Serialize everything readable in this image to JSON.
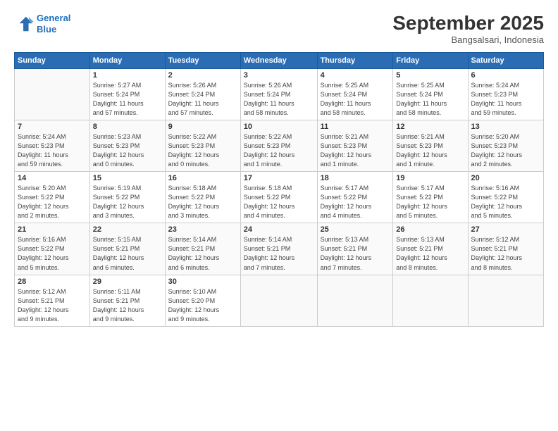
{
  "logo": {
    "line1": "General",
    "line2": "Blue"
  },
  "title": "September 2025",
  "subtitle": "Bangsalsari, Indonesia",
  "headers": [
    "Sunday",
    "Monday",
    "Tuesday",
    "Wednesday",
    "Thursday",
    "Friday",
    "Saturday"
  ],
  "weeks": [
    [
      {
        "day": "",
        "info": ""
      },
      {
        "day": "1",
        "info": "Sunrise: 5:27 AM\nSunset: 5:24 PM\nDaylight: 11 hours\nand 57 minutes."
      },
      {
        "day": "2",
        "info": "Sunrise: 5:26 AM\nSunset: 5:24 PM\nDaylight: 11 hours\nand 57 minutes."
      },
      {
        "day": "3",
        "info": "Sunrise: 5:26 AM\nSunset: 5:24 PM\nDaylight: 11 hours\nand 58 minutes."
      },
      {
        "day": "4",
        "info": "Sunrise: 5:25 AM\nSunset: 5:24 PM\nDaylight: 11 hours\nand 58 minutes."
      },
      {
        "day": "5",
        "info": "Sunrise: 5:25 AM\nSunset: 5:24 PM\nDaylight: 11 hours\nand 58 minutes."
      },
      {
        "day": "6",
        "info": "Sunrise: 5:24 AM\nSunset: 5:23 PM\nDaylight: 11 hours\nand 59 minutes."
      }
    ],
    [
      {
        "day": "7",
        "info": "Sunrise: 5:24 AM\nSunset: 5:23 PM\nDaylight: 11 hours\nand 59 minutes."
      },
      {
        "day": "8",
        "info": "Sunrise: 5:23 AM\nSunset: 5:23 PM\nDaylight: 12 hours\nand 0 minutes."
      },
      {
        "day": "9",
        "info": "Sunrise: 5:22 AM\nSunset: 5:23 PM\nDaylight: 12 hours\nand 0 minutes."
      },
      {
        "day": "10",
        "info": "Sunrise: 5:22 AM\nSunset: 5:23 PM\nDaylight: 12 hours\nand 1 minute."
      },
      {
        "day": "11",
        "info": "Sunrise: 5:21 AM\nSunset: 5:23 PM\nDaylight: 12 hours\nand 1 minute."
      },
      {
        "day": "12",
        "info": "Sunrise: 5:21 AM\nSunset: 5:23 PM\nDaylight: 12 hours\nand 1 minute."
      },
      {
        "day": "13",
        "info": "Sunrise: 5:20 AM\nSunset: 5:23 PM\nDaylight: 12 hours\nand 2 minutes."
      }
    ],
    [
      {
        "day": "14",
        "info": "Sunrise: 5:20 AM\nSunset: 5:22 PM\nDaylight: 12 hours\nand 2 minutes."
      },
      {
        "day": "15",
        "info": "Sunrise: 5:19 AM\nSunset: 5:22 PM\nDaylight: 12 hours\nand 3 minutes."
      },
      {
        "day": "16",
        "info": "Sunrise: 5:18 AM\nSunset: 5:22 PM\nDaylight: 12 hours\nand 3 minutes."
      },
      {
        "day": "17",
        "info": "Sunrise: 5:18 AM\nSunset: 5:22 PM\nDaylight: 12 hours\nand 4 minutes."
      },
      {
        "day": "18",
        "info": "Sunrise: 5:17 AM\nSunset: 5:22 PM\nDaylight: 12 hours\nand 4 minutes."
      },
      {
        "day": "19",
        "info": "Sunrise: 5:17 AM\nSunset: 5:22 PM\nDaylight: 12 hours\nand 5 minutes."
      },
      {
        "day": "20",
        "info": "Sunrise: 5:16 AM\nSunset: 5:22 PM\nDaylight: 12 hours\nand 5 minutes."
      }
    ],
    [
      {
        "day": "21",
        "info": "Sunrise: 5:16 AM\nSunset: 5:22 PM\nDaylight: 12 hours\nand 5 minutes."
      },
      {
        "day": "22",
        "info": "Sunrise: 5:15 AM\nSunset: 5:21 PM\nDaylight: 12 hours\nand 6 minutes."
      },
      {
        "day": "23",
        "info": "Sunrise: 5:14 AM\nSunset: 5:21 PM\nDaylight: 12 hours\nand 6 minutes."
      },
      {
        "day": "24",
        "info": "Sunrise: 5:14 AM\nSunset: 5:21 PM\nDaylight: 12 hours\nand 7 minutes."
      },
      {
        "day": "25",
        "info": "Sunrise: 5:13 AM\nSunset: 5:21 PM\nDaylight: 12 hours\nand 7 minutes."
      },
      {
        "day": "26",
        "info": "Sunrise: 5:13 AM\nSunset: 5:21 PM\nDaylight: 12 hours\nand 8 minutes."
      },
      {
        "day": "27",
        "info": "Sunrise: 5:12 AM\nSunset: 5:21 PM\nDaylight: 12 hours\nand 8 minutes."
      }
    ],
    [
      {
        "day": "28",
        "info": "Sunrise: 5:12 AM\nSunset: 5:21 PM\nDaylight: 12 hours\nand 9 minutes."
      },
      {
        "day": "29",
        "info": "Sunrise: 5:11 AM\nSunset: 5:21 PM\nDaylight: 12 hours\nand 9 minutes."
      },
      {
        "day": "30",
        "info": "Sunrise: 5:10 AM\nSunset: 5:20 PM\nDaylight: 12 hours\nand 9 minutes."
      },
      {
        "day": "",
        "info": ""
      },
      {
        "day": "",
        "info": ""
      },
      {
        "day": "",
        "info": ""
      },
      {
        "day": "",
        "info": ""
      }
    ]
  ]
}
